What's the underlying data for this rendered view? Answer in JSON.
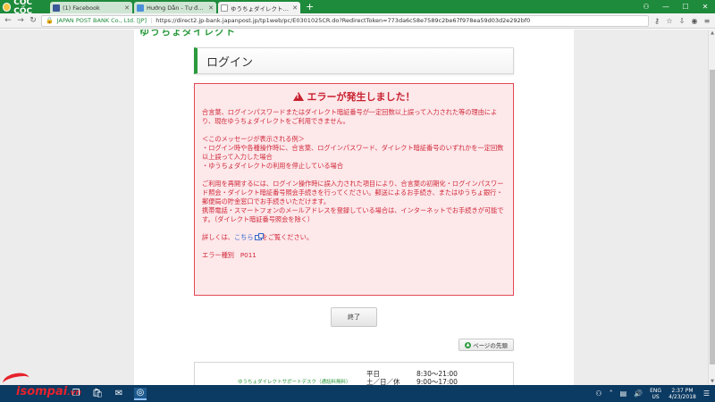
{
  "browser": {
    "brand": "CỐC CỐC",
    "tabs": [
      {
        "title": "(1) Facebook",
        "icon_color": "#3b5998",
        "active": false
      },
      {
        "title": "Hướng Dẫn - Tự đăng ký",
        "icon_color": "#4a90d9",
        "active": false
      },
      {
        "title": "ゆうちょダイレクト | エラー画面",
        "icon_color": "#ffffff",
        "active": true
      }
    ],
    "new_tab": "+",
    "secure_label": "JAPAN POST BANK Co., Ltd. [JP]",
    "url": "https://direct2.jp-bank.japanpost.jp/tp1web/pc/E0301025CR.do?RedirectToken=773da6c58e7589c2be67f978ea59d03d2e292bf0"
  },
  "page": {
    "login_title": "ログイン",
    "error": {
      "heading": "エラーが発生しました！",
      "para1": "合言葉、ログインパスワードまたはダイレクト暗証番号が一定回数以上誤って入力された等の理由により、現在ゆうちょダイレクトをご利用できません。",
      "examples_header": "＜このメッセージが表示される例＞",
      "example1": "・ログイン時や各種操作時に、合言葉、ログインパスワード、ダイレクト暗証番号のいずれかを一定回数以上誤って入力した場合",
      "example2": "・ゆうちょダイレクトの利用を停止している場合",
      "para3a": "ご利用を再開するには、ログイン操作時に誤入力された項目により、合言葉の初期化・ログインパスワード照会・ダイレクト暗証番号照会手続きを行ってください。郵送によるお手続き、またはゆうちょ銀行・郵便局の貯金窓口でお手続きいただけます。",
      "para3b": "携帯電話・スマートフォンのメールアドレスを登録している場合は、インターネットでお手続きが可能です。（ダイレクト暗証番号照会を除く）",
      "details_prefix": "詳しくは、",
      "details_link": "こちら",
      "details_suffix": "をご覧ください。",
      "error_type_label": "エラー種別",
      "error_code": "P011"
    },
    "end_button": "終了",
    "page_top": "ページの先頭",
    "support": {
      "name": "ゆうちょダイレクトサポートデスク（通話料無料）",
      "hours": [
        {
          "day": "平日",
          "time": "8:30～21:00"
        },
        {
          "day": "土／日／休日",
          "time": "9:00～17:00"
        }
      ]
    }
  },
  "taskbar": {
    "watermark": "isompai",
    "watermark_suffix": ".vn",
    "lang_top": "ENG",
    "lang_bottom": "US",
    "time": "2:37 PM",
    "date": "4/23/2018"
  },
  "colors": {
    "accent_green": "#1e8a3b",
    "error_red": "#d0293a",
    "error_bg": "#fde8ea"
  }
}
